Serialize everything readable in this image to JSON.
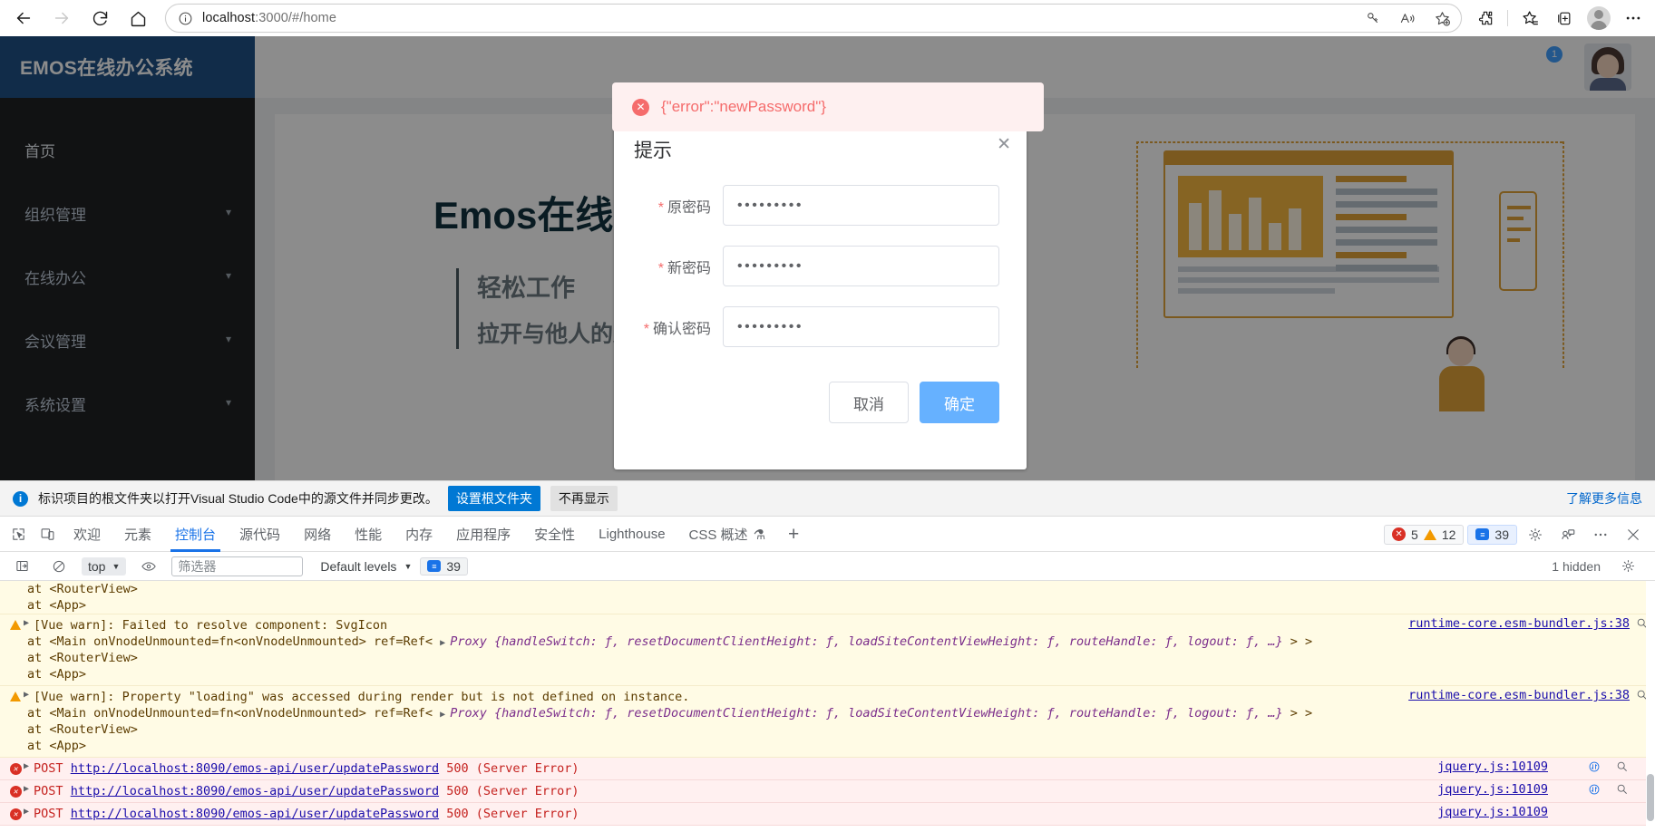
{
  "browser": {
    "back_label": "back-arrow",
    "forward_label": "forward-arrow",
    "reload_label": "reload",
    "home_label": "home",
    "url_prefix": "localhost",
    "url_suffix": ":3000/#/home",
    "url_full": "localhost:3000/#/home",
    "icons": {
      "site_info": "info-icon",
      "password_key": "key-icon",
      "read_aloud": "read-aloud-icon",
      "add_favorite": "add-favorite-icon",
      "extensions": "extensions-icon",
      "favorites": "favorites-icon",
      "collections": "collections-icon",
      "profile": "profile-avatar",
      "settings_more": "more-options-icon"
    }
  },
  "app": {
    "logo": "EMOS在线办公系统",
    "menu": [
      {
        "label": "首页",
        "expandable": false,
        "active": true
      },
      {
        "label": "组织管理",
        "expandable": true,
        "active": false
      },
      {
        "label": "在线办公",
        "expandable": true,
        "active": false
      },
      {
        "label": "会议管理",
        "expandable": true,
        "active": false
      },
      {
        "label": "系统设置",
        "expandable": true,
        "active": false
      }
    ],
    "topbar": {
      "notification_count": "1"
    },
    "hero": {
      "title": "Emos在线办公系统",
      "subtitle": "轻松工作",
      "subtitle2": "拉开与他人的距离"
    }
  },
  "toast": {
    "icon": "error-circle-icon",
    "close_glyph": "✕",
    "message": "{\"error\":\"newPassword\"}",
    "bg_color": "#fef0f0",
    "text_color": "#f56c6c"
  },
  "dialog": {
    "title": "提示",
    "close_glyph": "✕",
    "fields": [
      {
        "label": "原密码",
        "required": true,
        "value": "•••••••••"
      },
      {
        "label": "新密码",
        "required": true,
        "value": "•••••••••"
      },
      {
        "label": "确认密码",
        "required": true,
        "value": "•••••••••"
      }
    ],
    "cancel_label": "取消",
    "confirm_label": "确定",
    "confirm_color": "#66b1ff"
  },
  "notif_bar": {
    "icon": "info-icon",
    "message": "标识项目的根文件夹以打开Visual Studio Code中的源文件并同步更改。",
    "primary_button": "设置根文件夹",
    "secondary_button": "不再显示",
    "link": "了解更多信息"
  },
  "devtools": {
    "inspect_icon": "inspect-element-icon",
    "device_icon": "device-toolbar-icon",
    "tabs": [
      {
        "label": "欢迎",
        "active": false
      },
      {
        "label": "元素",
        "active": false
      },
      {
        "label": "控制台",
        "active": true
      },
      {
        "label": "源代码",
        "active": false
      },
      {
        "label": "网络",
        "active": false
      },
      {
        "label": "性能",
        "active": false
      },
      {
        "label": "内存",
        "active": false
      },
      {
        "label": "应用程序",
        "active": false
      },
      {
        "label": "安全性",
        "active": false
      },
      {
        "label": "Lighthouse",
        "active": false
      },
      {
        "label": "CSS 概述",
        "active": false
      }
    ],
    "add_tab_glyph": "+",
    "counters": {
      "errors": "5",
      "warnings": "12",
      "messages": "39"
    },
    "header_icons": {
      "settings": "gear-icon",
      "devices": "devices-icon",
      "more": "more-options-icon",
      "close": "close-icon"
    },
    "toolbar": {
      "sidebar_icon": "console-sidebar-icon",
      "clear_icon": "clear-console-icon",
      "context": "top",
      "eye_icon": "live-expression-icon",
      "filter_placeholder": "筛选器",
      "filter_value": "",
      "levels": "Default levels",
      "message_count": "39",
      "hidden_text": "1 hidden",
      "settings_icon": "gear-icon"
    },
    "console_rows": [
      {
        "type": "plain",
        "indent": true,
        "text": "at <RouterView>",
        "source": "",
        "source_icons": []
      },
      {
        "type": "plain",
        "indent": true,
        "text": "at <App>",
        "source": "",
        "source_icons": []
      },
      {
        "type": "warn",
        "indent": false,
        "toggle": "▶",
        "text": "[Vue warn]: Failed to resolve component: SvgIcon",
        "source": "runtime-core.esm-bundler.js:38",
        "source_icons": [
          "search-icon"
        ]
      },
      {
        "type": "warn",
        "indent": true,
        "text_pre": "at <Main onVnodeUnmounted=fn<onVnodeUnmounted> ref=Ref< ",
        "toggle2": "▶",
        "proxy": "Proxy {handleSwitch: ƒ, resetDocumentClientHeight: ƒ, loadSiteContentViewHeight: ƒ, routeHandle: ƒ, logout: ƒ, …}",
        "text_post": " > >",
        "source": "",
        "source_icons": []
      },
      {
        "type": "warn",
        "indent": true,
        "text": "at <RouterView>",
        "source": "",
        "source_icons": []
      },
      {
        "type": "warn",
        "indent": true,
        "text": "at <App>",
        "source": "",
        "source_icons": []
      },
      {
        "type": "warn",
        "indent": false,
        "toggle": "▶",
        "text": "[Vue warn]: Property \"loading\" was accessed during render but is not defined on instance.",
        "source": "runtime-core.esm-bundler.js:38",
        "source_icons": [
          "search-icon"
        ]
      },
      {
        "type": "warn",
        "indent": true,
        "text_pre": "at <Main onVnodeUnmounted=fn<onVnodeUnmounted> ref=Ref< ",
        "toggle2": "▶",
        "proxy": "Proxy {handleSwitch: ƒ, resetDocumentClientHeight: ƒ, loadSiteContentViewHeight: ƒ, routeHandle: ƒ, logout: ƒ, …}",
        "text_post": " > >",
        "source": "",
        "source_icons": []
      },
      {
        "type": "warn",
        "indent": true,
        "text": "at <RouterView>",
        "source": "",
        "source_icons": []
      },
      {
        "type": "warn",
        "indent": true,
        "text": "at <App>",
        "source": "",
        "source_icons": []
      },
      {
        "type": "error",
        "indent": false,
        "toggle": "▶",
        "method": "POST",
        "url": "http://localhost:8090/emos-api/user/updatePassword",
        "status": "500 (Server Error)",
        "source": "jquery.js:10109",
        "source_icons": [
          "network-icon",
          "search-icon"
        ]
      },
      {
        "type": "error",
        "indent": false,
        "toggle": "▶",
        "method": "POST",
        "url": "http://localhost:8090/emos-api/user/updatePassword",
        "status": "500 (Server Error)",
        "source": "jquery.js:10109",
        "source_icons": [
          "network-icon",
          "search-icon"
        ]
      },
      {
        "type": "error",
        "indent": false,
        "toggle": "▶",
        "method": "POST",
        "url": "http://localhost:8090/emos-api/user/updatePassword",
        "status": "500 (Server Error)",
        "source": "jquery.js:10109",
        "source_icons": [
          "network-icon",
          "search-icon"
        ]
      }
    ]
  }
}
